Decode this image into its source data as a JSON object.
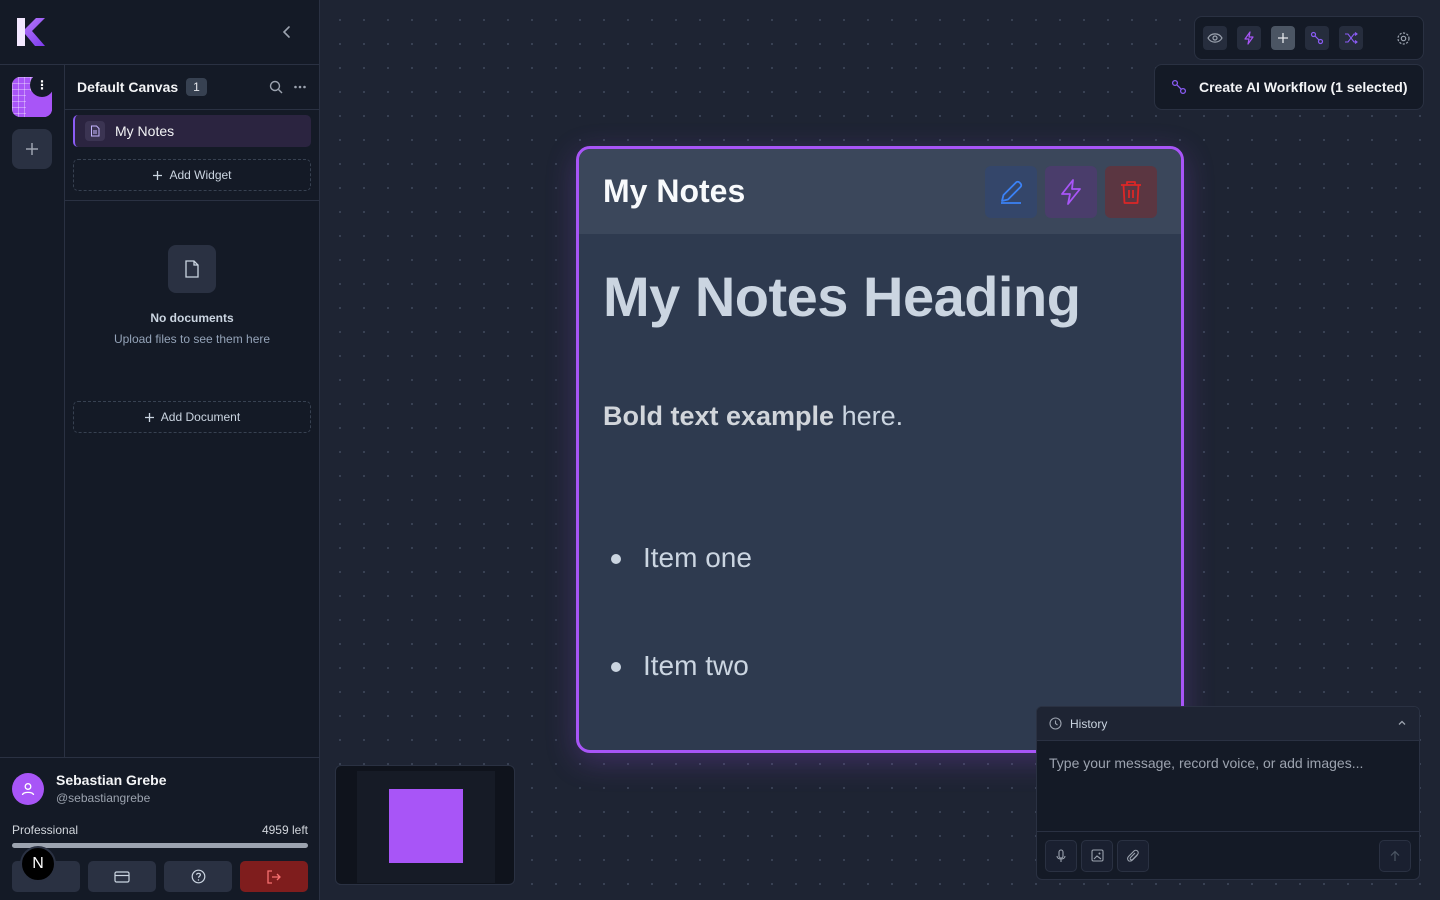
{
  "sidebar": {
    "canvas_name": "Default Canvas",
    "canvas_count": "1",
    "widgets": [
      {
        "label": "My Notes"
      }
    ],
    "add_widget_label": "Add Widget",
    "documents_empty_title": "No documents",
    "documents_empty_subtitle": "Upload files to see them here",
    "add_document_label": "Add Document"
  },
  "user": {
    "name": "Sebastian Grebe",
    "handle": "@sebastiangrebe",
    "plan": "Professional",
    "credits_left": "4959 left",
    "usage_fraction": 1.0,
    "badge_letter": "N"
  },
  "toolbar": {
    "icons": [
      "eye-icon",
      "bolt-icon",
      "plus-icon",
      "workflow-icon",
      "shuffle-icon",
      "gear-icon"
    ],
    "workflow_button_label": "Create AI Workflow (1 selected)"
  },
  "widget": {
    "title": "My Notes",
    "heading": "My Notes Heading",
    "bold_text": "Bold text example",
    "rest_text": " here.",
    "list_items": [
      "Item one",
      "Item two"
    ]
  },
  "chat": {
    "history_label": "History",
    "placeholder": "Type your message, record voice, or add images..."
  },
  "colors": {
    "accent": "#a855f7",
    "background": "#1e2433",
    "sidebar": "#141a26",
    "danger": "#dc2626",
    "edit": "#3b82f6"
  }
}
